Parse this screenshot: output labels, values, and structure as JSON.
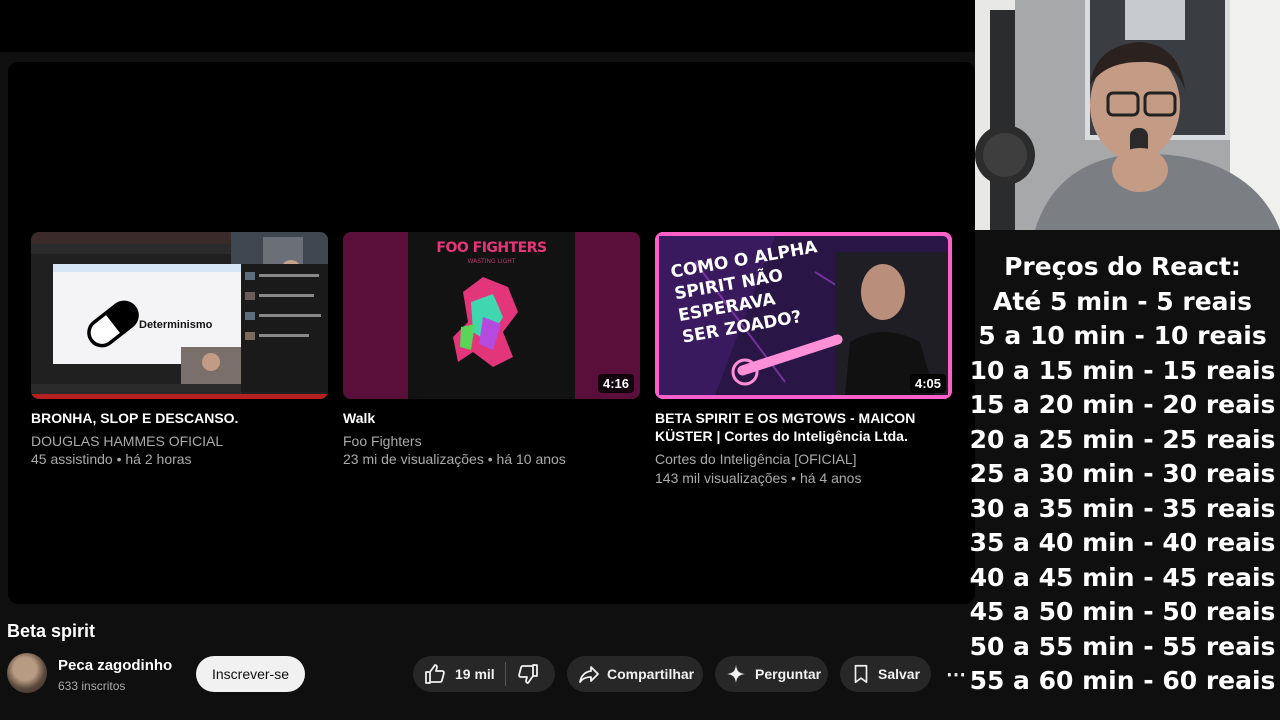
{
  "videos": [
    {
      "title": "BRONHA, SLOP E DESCANSO.",
      "channel": "DOUGLAS HAMMES OFICIAL",
      "meta": "45 assistindo • há 2 horas",
      "thumb_text": "Determinismo"
    },
    {
      "title": "Walk",
      "channel": "Foo Fighters",
      "meta": "23 mi de visualizações • há 10 anos",
      "duration": "4:16",
      "thumb_band": "FOO FIGHTERS",
      "thumb_album": "WASTING LIGHT"
    },
    {
      "title": "BETA SPIRIT E OS MGTOWS - MAICON KÜSTER | Cortes do Inteligência Ltda.",
      "channel": "Cortes do Inteligência [OFICIAL]",
      "meta": "143 mil visualizações • há 4 anos",
      "duration": "4:05",
      "thumb_lines": [
        "COMO O ALPHA",
        "SPIRIT NÃO",
        "ESPERAVA",
        "SER ZOADO?"
      ]
    }
  ],
  "current_video": {
    "title": "Beta spirit",
    "channel_name": "Peca zagodinho",
    "subscribers": "633 inscritos",
    "subscribe_label": "Inscrever-se",
    "likes": "19 mil",
    "share_label": "Compartilhar",
    "ask_label": "Perguntar",
    "save_label": "Salvar",
    "more_label": "⋯"
  },
  "prices": {
    "title": "Preços do React:",
    "items": [
      "Até 5 min - 5 reais",
      "5 a 10 min - 10 reais",
      "10 a 15 min - 15 reais",
      "15 a 20 min - 20 reais",
      "20 a 25 min - 25 reais",
      "25 a 30 min - 30 reais",
      "30 a 35 min - 35 reais",
      "35 a 40 min - 40 reais",
      "40 a 45 min - 45 reais",
      "45 a 50 min - 50 reais",
      "50 a 55 min - 55 reais",
      "55 a 60 min - 60 reais"
    ]
  },
  "colors": {
    "background": "#0f0f0f",
    "player": "#000000",
    "pill": "#272727",
    "thumb_pink": "#ff5fc8",
    "maroon": "#5a0e3a"
  }
}
